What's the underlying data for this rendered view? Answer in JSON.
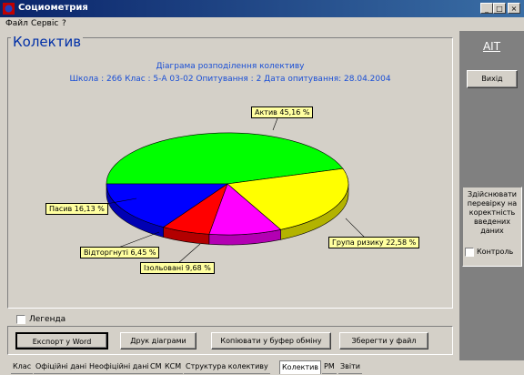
{
  "window": {
    "title": "Социометрия"
  },
  "menu": [
    "Файл",
    "Сервіс",
    "?"
  ],
  "panel": {
    "title": "Колектив"
  },
  "chart_data": {
    "type": "pie",
    "title": "Діаграма розподілення колективу",
    "subtitle": "Школа : 266  Клас : 5-А 03-02  Опитування : 2  Дата опитування: 28.04.2004",
    "slices": [
      {
        "label": "Актив 45,16 %",
        "value": 45.16,
        "color": "#00ff00"
      },
      {
        "label": "Група ризику 22,58 %",
        "value": 22.58,
        "color": "#ffff00"
      },
      {
        "label": "Ізольовані 9,68 %",
        "value": 9.68,
        "color": "#ff00ff"
      },
      {
        "label": "Відторгнуті 6,45 %",
        "value": 6.45,
        "color": "#ff0000"
      },
      {
        "label": "Пасив 16,13 %",
        "value": 16.13,
        "color": "#0000ff"
      }
    ]
  },
  "right": {
    "logo": "AIT",
    "exit_label": "Вихід",
    "verify_text": "Здійснювати перевірку на коректність введених даних",
    "control_label": "Контроль"
  },
  "legend_label": "Легенда",
  "buttons": {
    "export": "Експорт у Word",
    "print": "Друк діаграми",
    "copy": "Копіювати у буфер обміну",
    "save": "Зберегти у файл"
  },
  "tabs": [
    "Клас",
    "Офіційні дані",
    "Неофіційні дані",
    "СМ",
    "КСМ",
    "Структура колективу",
    "Колектив",
    "РМ",
    "Звіти"
  ],
  "active_tab": "Колектив"
}
